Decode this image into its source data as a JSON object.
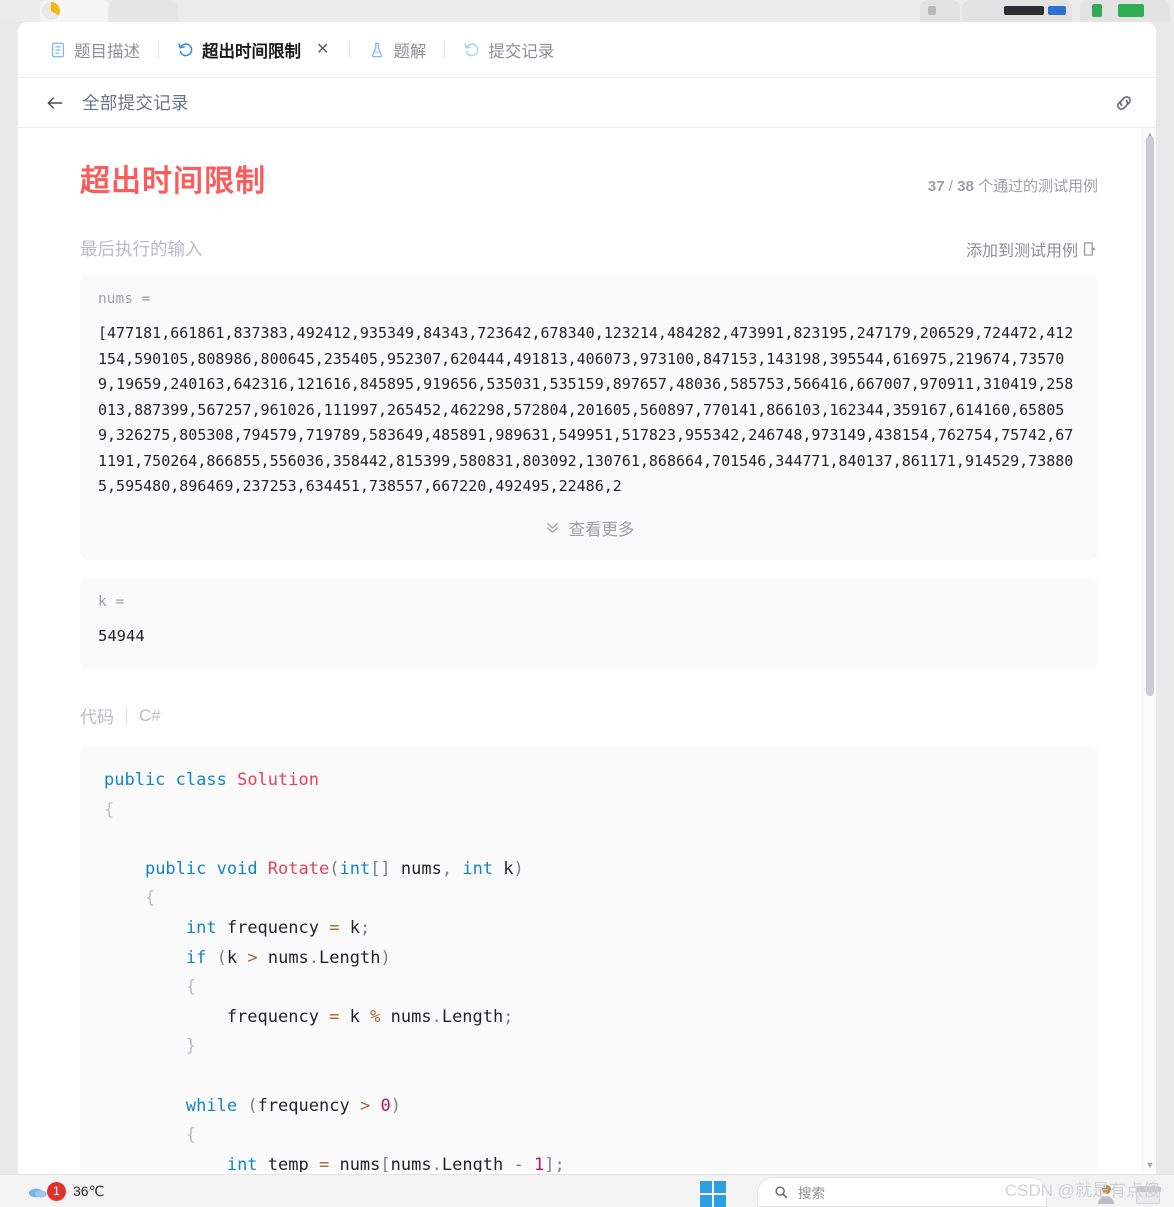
{
  "browser": {
    "logo_icon": "chrome-logo-icon"
  },
  "tabs": [
    {
      "label": "题目描述",
      "icon": "document-icon",
      "active": false,
      "closable": false
    },
    {
      "label": "超出时间限制",
      "icon": "history-icon",
      "active": true,
      "closable": true,
      "close_label": "✕"
    },
    {
      "label": "题解",
      "icon": "flask-icon",
      "active": false,
      "closable": false
    },
    {
      "label": "提交记录",
      "icon": "history-icon",
      "active": false,
      "closable": false
    }
  ],
  "subheader": {
    "back_icon": "back-arrow-icon",
    "title": "全部提交记录",
    "link_icon": "link-icon"
  },
  "result": {
    "verdict": "超出时间限制",
    "verdict_color": "#fa5c5c",
    "passed": "37",
    "total": "38",
    "testcases_suffix": "个通过的测试用例",
    "separator": "/"
  },
  "last_input": {
    "heading": "最后执行的输入",
    "add_testcase_label": "添加到测试用例",
    "add_testcase_icon": "add-testcase-icon",
    "see_more_label": "查看更多",
    "see_more_icon": "chevron-double-down-icon",
    "fields": [
      {
        "name": "nums =",
        "value": "[477181,661861,837383,492412,935349,84343,723642,678340,123214,484282,473991,823195,247179,206529,724472,412154,590105,808986,800645,235405,952307,620444,491813,406073,973100,847153,143198,395544,616975,219674,735709,19659,240163,642316,121616,845895,919656,535031,535159,897657,48036,585753,566416,667007,970911,310419,258013,887399,567257,961026,111997,265452,462298,572804,201605,560897,770141,866103,162344,359167,614160,658059,326275,805308,794579,719789,583649,485891,989631,549951,517823,955342,246748,973149,438154,762754,75742,671191,750264,866855,556036,358442,815399,580831,803092,130761,868664,701546,344771,840137,861171,914529,738805,595480,896469,237253,634451,738557,667220,492495,22486,2"
      },
      {
        "name": "k =",
        "value": "54944"
      }
    ]
  },
  "code_section": {
    "label": "代码",
    "language": "C#",
    "lines": [
      [
        {
          "t": "public ",
          "c": "k"
        },
        {
          "t": "class ",
          "c": "k"
        },
        {
          "t": "Solution",
          "c": "ty"
        }
      ],
      [
        {
          "t": "{",
          "c": "br"
        }
      ],
      [
        {
          "t": "",
          "c": "id"
        }
      ],
      [
        {
          "t": "    ",
          "c": "id"
        },
        {
          "t": "public ",
          "c": "k"
        },
        {
          "t": "void ",
          "c": "k"
        },
        {
          "t": "Rotate",
          "c": "ty"
        },
        {
          "t": "(",
          "c": "pn"
        },
        {
          "t": "int",
          "c": "k"
        },
        {
          "t": "[]",
          "c": "pn"
        },
        {
          "t": " nums",
          "c": "id"
        },
        {
          "t": ", ",
          "c": "pn"
        },
        {
          "t": "int",
          "c": "k"
        },
        {
          "t": " k",
          "c": "id"
        },
        {
          "t": ")",
          "c": "pn"
        }
      ],
      [
        {
          "t": "    {",
          "c": "br"
        }
      ],
      [
        {
          "t": "        ",
          "c": "id"
        },
        {
          "t": "int",
          "c": "k"
        },
        {
          "t": " frequency ",
          "c": "id"
        },
        {
          "t": "=",
          "c": "op"
        },
        {
          "t": " k",
          "c": "id"
        },
        {
          "t": ";",
          "c": "pn"
        }
      ],
      [
        {
          "t": "        ",
          "c": "id"
        },
        {
          "t": "if",
          "c": "k"
        },
        {
          "t": " ",
          "c": "id"
        },
        {
          "t": "(",
          "c": "pn"
        },
        {
          "t": "k ",
          "c": "id"
        },
        {
          "t": ">",
          "c": "op"
        },
        {
          "t": " nums",
          "c": "id"
        },
        {
          "t": ".",
          "c": "pn"
        },
        {
          "t": "Length",
          "c": "id"
        },
        {
          "t": ")",
          "c": "pn"
        }
      ],
      [
        {
          "t": "        {",
          "c": "br"
        }
      ],
      [
        {
          "t": "            frequency ",
          "c": "id"
        },
        {
          "t": "=",
          "c": "op"
        },
        {
          "t": " k ",
          "c": "id"
        },
        {
          "t": "%",
          "c": "op"
        },
        {
          "t": " nums",
          "c": "id"
        },
        {
          "t": ".",
          "c": "pn"
        },
        {
          "t": "Length",
          "c": "id"
        },
        {
          "t": ";",
          "c": "pn"
        }
      ],
      [
        {
          "t": "        }",
          "c": "br"
        }
      ],
      [
        {
          "t": "",
          "c": "id"
        }
      ],
      [
        {
          "t": "        ",
          "c": "id"
        },
        {
          "t": "while",
          "c": "k"
        },
        {
          "t": " ",
          "c": "id"
        },
        {
          "t": "(",
          "c": "pn"
        },
        {
          "t": "frequency ",
          "c": "id"
        },
        {
          "t": ">",
          "c": "op"
        },
        {
          "t": " ",
          "c": "id"
        },
        {
          "t": "0",
          "c": "nu"
        },
        {
          "t": ")",
          "c": "pn"
        }
      ],
      [
        {
          "t": "        {",
          "c": "br"
        }
      ],
      [
        {
          "t": "            ",
          "c": "id"
        },
        {
          "t": "int",
          "c": "k"
        },
        {
          "t": " temp ",
          "c": "id"
        },
        {
          "t": "=",
          "c": "op"
        },
        {
          "t": " nums",
          "c": "id"
        },
        {
          "t": "[",
          "c": "pn"
        },
        {
          "t": "nums",
          "c": "id"
        },
        {
          "t": ".",
          "c": "pn"
        },
        {
          "t": "Length ",
          "c": "id"
        },
        {
          "t": "-",
          "c": "op"
        },
        {
          "t": " ",
          "c": "id"
        },
        {
          "t": "1",
          "c": "nu"
        },
        {
          "t": "]",
          "c": "pn"
        },
        {
          "t": ";",
          "c": "pn"
        }
      ]
    ]
  },
  "taskbar": {
    "temperature": "36℃",
    "notification_count": "1",
    "weather_icon": "cloud-icon",
    "start_icon": "windows-start-icon",
    "search_placeholder": "搜索",
    "search_icon": "search-icon"
  },
  "watermark": "CSDN @就是有点傻"
}
